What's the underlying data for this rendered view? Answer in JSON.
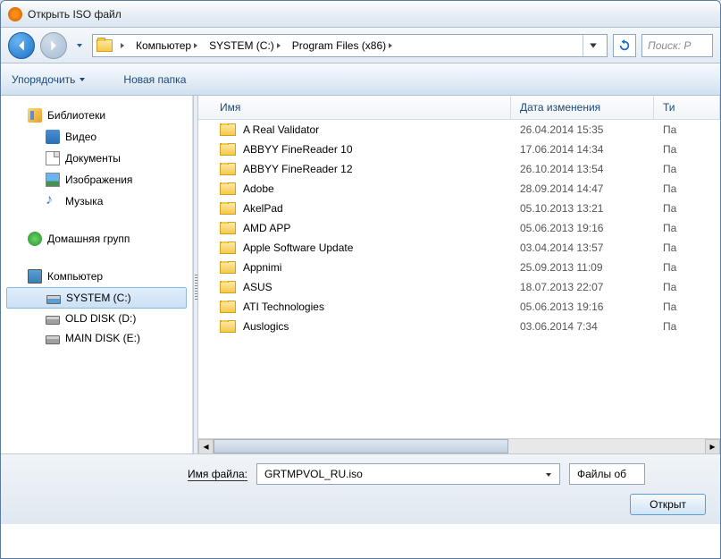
{
  "window": {
    "title": "Открыть ISO файл"
  },
  "breadcrumb": {
    "items": [
      {
        "label": "Компьютер"
      },
      {
        "label": "SYSTEM (C:)"
      },
      {
        "label": "Program Files (x86)"
      }
    ]
  },
  "search": {
    "placeholder": "Поиск: P"
  },
  "toolbar": {
    "organize": "Упорядочить",
    "newfolder": "Новая папка"
  },
  "sidebar": {
    "libraries": {
      "label": "Библиотеки",
      "items": [
        {
          "label": "Видео"
        },
        {
          "label": "Документы"
        },
        {
          "label": "Изображения"
        },
        {
          "label": "Музыка"
        }
      ]
    },
    "homegroup": {
      "label": "Домашняя групп"
    },
    "computer": {
      "label": "Компьютер",
      "items": [
        {
          "label": "SYSTEM (C:)",
          "selected": true
        },
        {
          "label": "OLD DISK (D:)"
        },
        {
          "label": "MAIN DISK (E:)"
        }
      ]
    }
  },
  "columns": {
    "name": "Имя",
    "date": "Дата изменения",
    "type": "Ти"
  },
  "files": [
    {
      "name": "A Real Validator",
      "date": "26.04.2014 15:35",
      "type": "Па"
    },
    {
      "name": "ABBYY FineReader 10",
      "date": "17.06.2014 14:34",
      "type": "Па"
    },
    {
      "name": "ABBYY FineReader 12",
      "date": "26.10.2014 13:54",
      "type": "Па"
    },
    {
      "name": "Adobe",
      "date": "28.09.2014 14:47",
      "type": "Па"
    },
    {
      "name": "AkelPad",
      "date": "05.10.2013 13:21",
      "type": "Па"
    },
    {
      "name": "AMD APP",
      "date": "05.06.2013 19:16",
      "type": "Па"
    },
    {
      "name": "Apple Software Update",
      "date": "03.04.2014 13:57",
      "type": "Па"
    },
    {
      "name": "Appnimi",
      "date": "25.09.2013 11:09",
      "type": "Па"
    },
    {
      "name": "ASUS",
      "date": "18.07.2013 22:07",
      "type": "Па"
    },
    {
      "name": "ATI Technologies",
      "date": "05.06.2013 19:16",
      "type": "Па"
    },
    {
      "name": "Auslogics",
      "date": "03.06.2014 7:34",
      "type": "Па"
    }
  ],
  "footer": {
    "filename_label": "Имя файла:",
    "filename_value": "GRTMPVOL_RU.iso",
    "filter": "Файлы об",
    "open": "Открыт"
  }
}
